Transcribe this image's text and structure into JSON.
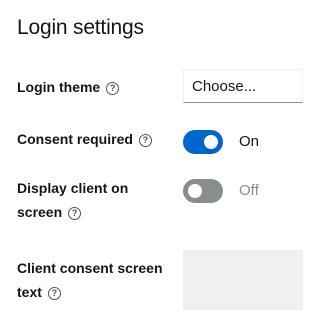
{
  "section": {
    "title": "Login settings"
  },
  "login_theme": {
    "label": "Login theme",
    "placeholder": "Choose..."
  },
  "consent_required": {
    "label": "Consent required",
    "state_text": "On",
    "checked": true
  },
  "display_client": {
    "label_line1": "Display client on",
    "label_line2": "screen",
    "state_text": "Off",
    "checked": false
  },
  "consent_text": {
    "label_line1": "Client consent screen",
    "label_line2": "text",
    "value": ""
  },
  "help_glyph": "?"
}
